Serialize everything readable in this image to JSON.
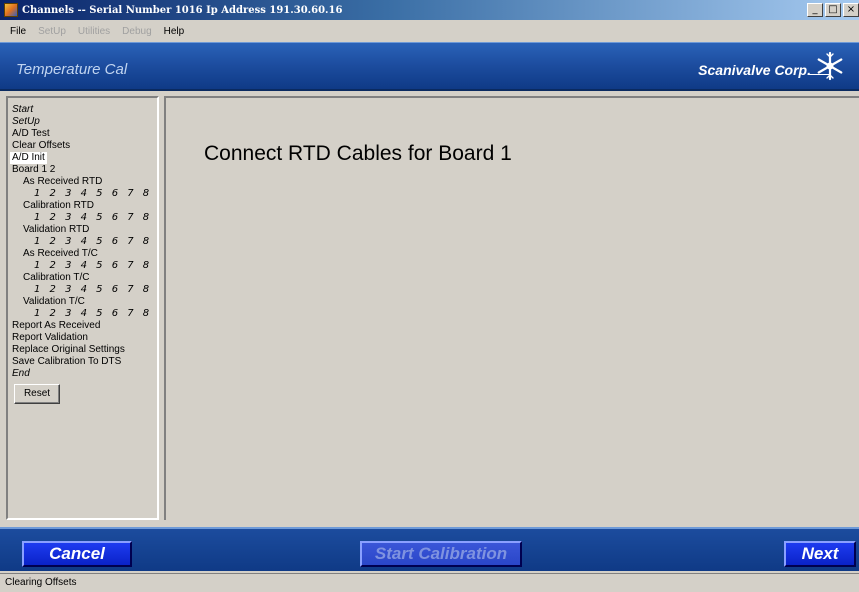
{
  "window": {
    "title": "Channels -- Serial Number 1016 Ip Address 191.30.60.16",
    "controls": {
      "minimize": "_",
      "maximize": "□",
      "close": "×"
    }
  },
  "menu": {
    "items": [
      {
        "label": "File",
        "enabled": true
      },
      {
        "label": "SetUp",
        "enabled": false
      },
      {
        "label": "Utilities",
        "enabled": false
      },
      {
        "label": "Debug",
        "enabled": false
      },
      {
        "label": "Help",
        "enabled": true
      }
    ]
  },
  "header": {
    "title": "Temperature Cal",
    "brand": "Scanivalve Corp.",
    "logo_icon": "snowflake-logo-icon"
  },
  "nav": {
    "start": "Start",
    "setup": "SetUp",
    "ad_test": "A/D Test",
    "clear_offsets": "Clear Offsets",
    "ad_init": "A/D Init",
    "board": "Board 1  2",
    "as_received_rtd": "As Received RTD",
    "calibration_rtd": "Calibration RTD",
    "validation_rtd": "Validation RTD",
    "as_received_tc": "As Received T/C",
    "calibration_tc": "Calibration T/C",
    "validation_tc": "Validation T/C",
    "channel_numbers": "1 2 3 4 5 6 7 8",
    "report_as_received": "Report As Received",
    "report_validation": "Report Validation",
    "replace_original": "Replace Original Settings",
    "save_calibration": "Save Calibration To DTS",
    "end": "End",
    "reset_button": "Reset",
    "selected_item": "A/D Init"
  },
  "main": {
    "heading": "Connect RTD Cables for Board 1"
  },
  "footer": {
    "cancel_label": "Cancel",
    "start_label": "Start Calibration",
    "start_enabled": false,
    "next_label": "Next"
  },
  "status": {
    "text": "Clearing Offsets"
  },
  "colors": {
    "band_blue": "#1c4c9e",
    "button_blue": "#0a22c8",
    "panel_gray": "#d4d0c8"
  }
}
